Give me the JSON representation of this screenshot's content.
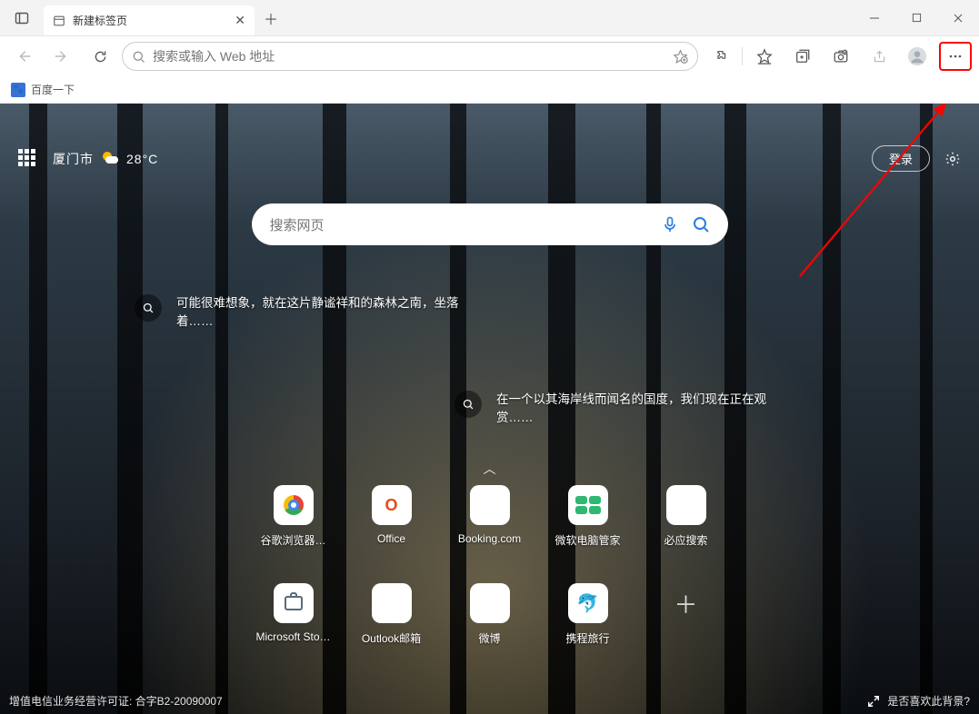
{
  "tab": {
    "title": "新建标签页"
  },
  "omnibox": {
    "placeholder": "搜索或输入 Web 地址"
  },
  "bookmarks": {
    "baidu": "百度一下"
  },
  "weather": {
    "city": "厦门市",
    "temp": "28°C"
  },
  "login_label": "登录",
  "search": {
    "placeholder": "搜索网页"
  },
  "story1": "可能很难想象，就在这片静谧祥和的森林之南，坐落着……",
  "story2": "在一个以其海岸线而闻名的国度，我们现在正在观赏……",
  "tiles": [
    {
      "label": "谷歌浏览器…"
    },
    {
      "label": "Office"
    },
    {
      "label": "Booking.com"
    },
    {
      "label": "微软电脑管家"
    },
    {
      "label": "必应搜索"
    },
    {
      "label": "Microsoft Sto…"
    },
    {
      "label": "Outlook邮箱"
    },
    {
      "label": "微博"
    },
    {
      "label": "携程旅行"
    },
    {
      "label": ""
    }
  ],
  "footer": {
    "license": "增值电信业务经营许可证: 合字B2-20090007",
    "like_bg": "是否喜欢此背景?"
  }
}
